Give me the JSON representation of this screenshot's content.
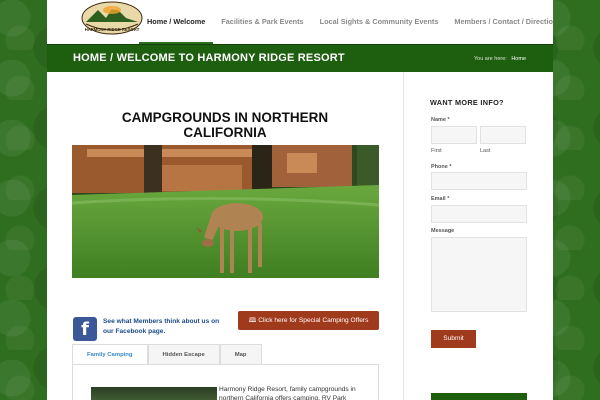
{
  "header": {
    "logo_text": "HARMONY RIDGE RESORT",
    "nav": [
      {
        "label": "Home / Welcome"
      },
      {
        "label": "Facilities & Park Events"
      },
      {
        "label": "Local Sights & Community Events"
      },
      {
        "label": "Members / Contact / Directions"
      }
    ]
  },
  "titlebar": {
    "title": "HOME / WELCOME TO HARMONY RIDGE RESORT",
    "breadcrumb_prefix": "You are here:",
    "breadcrumb_link": "Home"
  },
  "main": {
    "heading": "CAMPGROUNDS IN NORTHERN CALIFORNIA",
    "facebook_text": "See what Members think about us on our Facebook page.",
    "offer_button": "🕮 Click here for Special Camping Offers",
    "tabs": [
      {
        "label": "Family Camping"
      },
      {
        "label": "Hidden Escape"
      },
      {
        "label": "Map"
      }
    ],
    "tab_text": "Harmony Ridge Resort, family campgrounds in northern California offers camping, RV Park"
  },
  "sidebar": {
    "heading": "WANT MORE INFO?",
    "name_label": "Name *",
    "first_label": "First",
    "last_label": "Last",
    "phone_label": "Phone *",
    "email_label": "Email *",
    "message_label": "Message",
    "submit_label": "Submit"
  },
  "colors": {
    "brand_green": "#1e5e0f",
    "button_red": "#a03a1c",
    "facebook_blue": "#3b5998",
    "active_tab_blue": "#3a88c9"
  }
}
